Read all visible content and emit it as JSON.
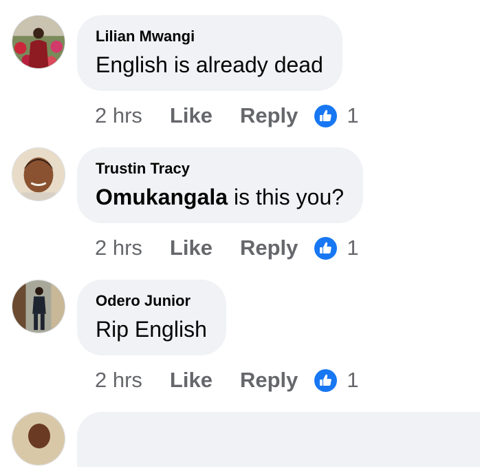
{
  "comments": [
    {
      "author": "Lilian Mwangi",
      "mention": "",
      "text": "English is already dead",
      "time": "2 hrs",
      "like_label": "Like",
      "reply_label": "Reply",
      "reaction_count": "1",
      "reaction_icon": "thumbs-up-icon"
    },
    {
      "author": "Trustin Tracy",
      "mention": "Omukangala",
      "text": " is this you?",
      "time": "2 hrs",
      "like_label": "Like",
      "reply_label": "Reply",
      "reaction_count": "1",
      "reaction_icon": "thumbs-up-icon"
    },
    {
      "author": "Odero Junior",
      "mention": "",
      "text": "Rip English",
      "time": "2 hrs",
      "like_label": "Like",
      "reply_label": "Reply",
      "reaction_count": "1",
      "reaction_icon": "thumbs-up-icon"
    }
  ],
  "colors": {
    "reaction_blue": "#1877f2",
    "bubble_bg": "#f0f2f5",
    "meta_gray": "#65676b",
    "text": "#050505"
  }
}
